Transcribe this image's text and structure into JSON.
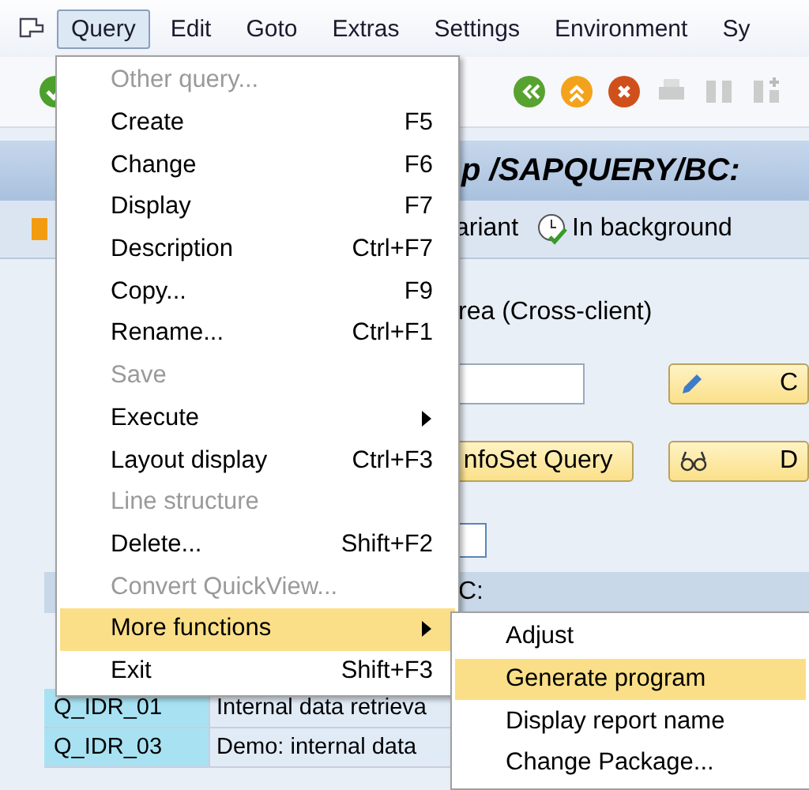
{
  "menubar": {
    "items": [
      {
        "label": "Query",
        "selected": true
      },
      {
        "label": "Edit",
        "selected": false
      },
      {
        "label": "Goto",
        "selected": false
      },
      {
        "label": "Extras",
        "selected": false
      },
      {
        "label": "Settings",
        "selected": false
      },
      {
        "label": "Environment",
        "selected": false
      },
      {
        "label": "Sy",
        "selected": false
      }
    ]
  },
  "title_bar": {
    "title": "p /SAPQUERY/BC:"
  },
  "app_toolbar": {
    "items": [
      "ariant",
      "In background"
    ]
  },
  "content": {
    "area_label": "rea (Cross-client)",
    "buttons": [
      {
        "label": "C",
        "kind": "edit"
      },
      {
        "label": "nfoSet Query",
        "kind": "plain"
      },
      {
        "label": "D",
        "kind": "describe"
      }
    ],
    "table_header": "C:"
  },
  "table": {
    "rows": [
      {
        "name": "Q_IDR_01",
        "title": "Internal data retrieva"
      },
      {
        "name": "Q_IDR_03",
        "title": "Demo: internal data"
      }
    ]
  },
  "menu": {
    "items": [
      {
        "label": "Other query...",
        "disabled": true,
        "submenu": false,
        "selected": false
      },
      {
        "label": "Create",
        "shortcut": "F5",
        "disabled": false,
        "submenu": false,
        "selected": false
      },
      {
        "label": "Change",
        "shortcut": "F6",
        "disabled": false,
        "submenu": false,
        "selected": false
      },
      {
        "label": "Display",
        "shortcut": "F7",
        "disabled": false,
        "submenu": false,
        "selected": false
      },
      {
        "label": "Description",
        "shortcut": "Ctrl+F7",
        "disabled": false,
        "submenu": false,
        "selected": false
      },
      {
        "label": "Copy...",
        "shortcut": "F9",
        "disabled": false,
        "submenu": false,
        "selected": false
      },
      {
        "label": "Rename...",
        "shortcut": "Ctrl+F1",
        "disabled": false,
        "submenu": false,
        "selected": false
      },
      {
        "label": "Save",
        "disabled": true,
        "submenu": false,
        "selected": false
      },
      {
        "label": "Execute",
        "disabled": false,
        "submenu": true,
        "selected": false
      },
      {
        "label": "Layout display",
        "shortcut": "Ctrl+F3",
        "disabled": false,
        "submenu": false,
        "selected": false
      },
      {
        "label": "Line structure",
        "disabled": true,
        "submenu": false,
        "selected": false
      },
      {
        "label": "Delete...",
        "shortcut": "Shift+F2",
        "disabled": false,
        "submenu": false,
        "selected": false
      },
      {
        "label": "Convert QuickView...",
        "disabled": true,
        "submenu": false,
        "selected": false
      },
      {
        "label": "More functions",
        "disabled": false,
        "submenu": true,
        "selected": true
      },
      {
        "label": "Exit",
        "shortcut": "Shift+F3",
        "disabled": false,
        "submenu": false,
        "selected": false
      }
    ]
  },
  "submenu": {
    "items": [
      {
        "label": "Adjust",
        "selected": false
      },
      {
        "label": "Generate program",
        "selected": true
      },
      {
        "label": "Display report name",
        "selected": false
      },
      {
        "label": "Change Package...",
        "selected": false
      }
    ]
  }
}
